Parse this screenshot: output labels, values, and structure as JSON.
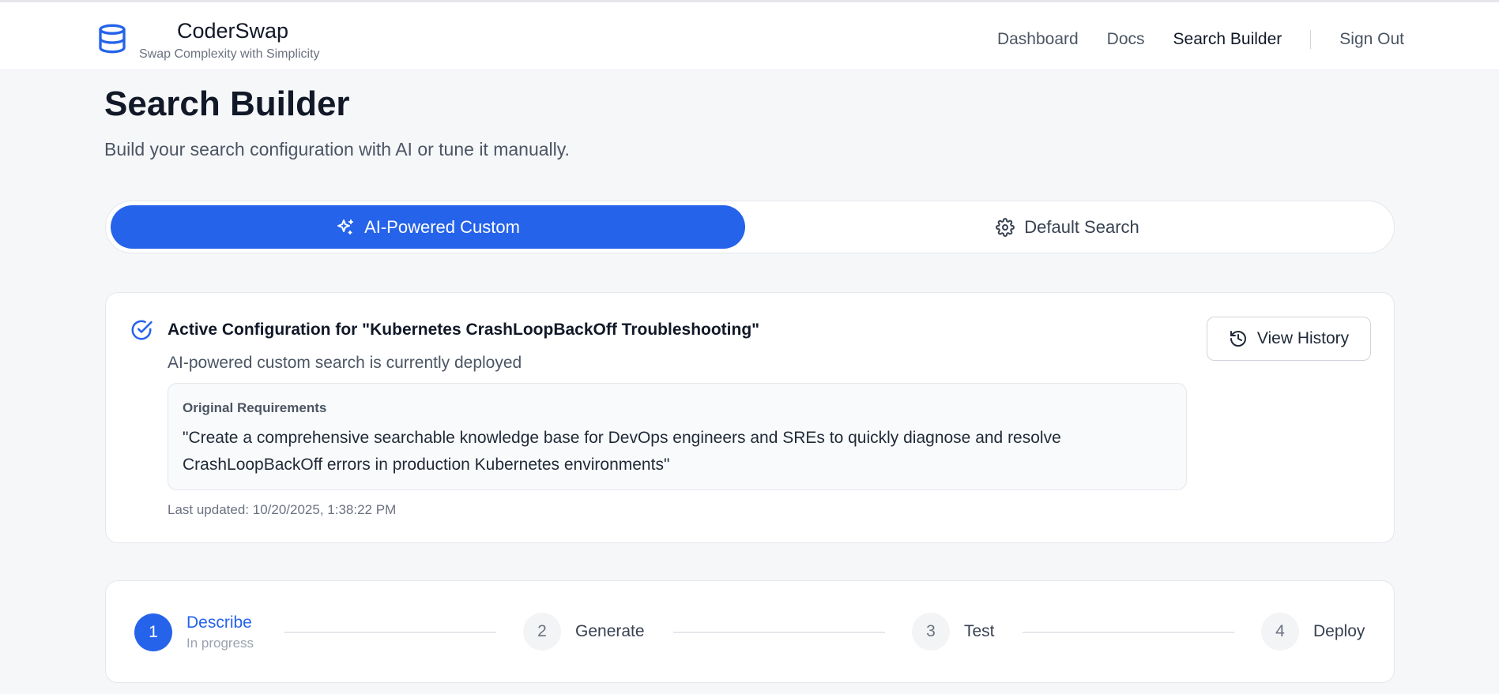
{
  "brand": {
    "name": "CoderSwap",
    "tagline": "Swap Complexity with Simplicity",
    "icon": "database-icon"
  },
  "nav": {
    "links": [
      "Dashboard",
      "Docs",
      "Search Builder"
    ],
    "active": "Search Builder",
    "sign_out": "Sign Out"
  },
  "page": {
    "title": "Search Builder",
    "subtitle": "Build your search configuration with AI or tune it manually."
  },
  "modes": {
    "ai_label": "AI-Powered Custom",
    "ai_icon": "sparkles-icon",
    "default_label": "Default Search",
    "default_icon": "gear-icon",
    "selected": "AI-Powered Custom"
  },
  "config": {
    "title": "Active Configuration for \"Kubernetes CrashLoopBackOff Troubleshooting\"",
    "subtitle": "AI-powered custom search is currently deployed",
    "requirements_label": "Original Requirements",
    "requirements_text": "\"Create a comprehensive searchable knowledge base for DevOps engineers and SREs to quickly diagnose and resolve CrashLoopBackOff errors in production Kubernetes environments\"",
    "last_updated": "Last updated: 10/20/2025, 1:38:22 PM",
    "history_button": "View History"
  },
  "steps": [
    {
      "number": "1",
      "label": "Describe",
      "status": "In progress"
    },
    {
      "number": "2",
      "label": "Generate",
      "status": ""
    },
    {
      "number": "3",
      "label": "Test",
      "status": ""
    },
    {
      "number": "4",
      "label": "Deploy",
      "status": ""
    }
  ],
  "colors": {
    "accent": "#2563eb",
    "background": "#f6f7f9",
    "text": "#111827",
    "muted": "#6b7280"
  }
}
